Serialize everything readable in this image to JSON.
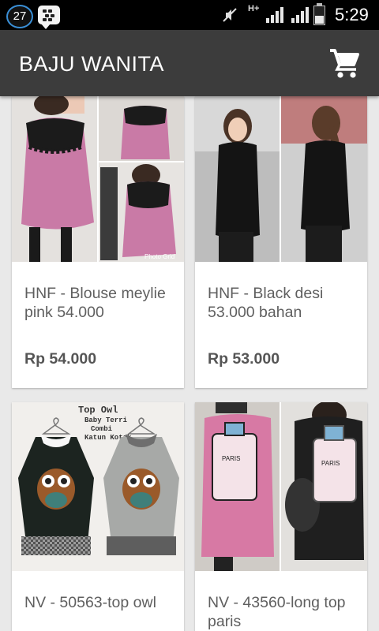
{
  "status_bar": {
    "notification_count": "27",
    "network_type": "H+",
    "time": "5:29"
  },
  "app_bar": {
    "title": "BAJU WANITA",
    "cart_icon": "shopping-cart-icon"
  },
  "products": [
    {
      "name": "HNF - Blouse meylie pink 54.000",
      "price": "Rp 54.000",
      "image_text": "Photo Grid",
      "colors": {
        "garment": "#c97aa6",
        "accent": "#1b1b1b"
      }
    },
    {
      "name": "HNF - Black desi 53.000 bahan",
      "price": "Rp 53.000",
      "colors": {
        "garment": "#141414",
        "accent": "#b9b9b9"
      }
    },
    {
      "name": "NV - 50563-top owl",
      "price": "",
      "image_text": [
        "Top Owl",
        "Baby Terri",
        "Combi",
        "Katun Kotak"
      ],
      "colors": {
        "garment": "#1c2420",
        "accent": "#9c9c9c"
      }
    },
    {
      "name": "NV - 43560-long top paris",
      "price": "",
      "image_text": "PARIS",
      "colors": {
        "garment": "#d779a4",
        "accent": "#1f1f1f"
      }
    }
  ],
  "colors": {
    "status_bar": "#000000",
    "app_bar": "#3c3c3c",
    "background": "#e9e9e9",
    "card": "#ffffff"
  }
}
